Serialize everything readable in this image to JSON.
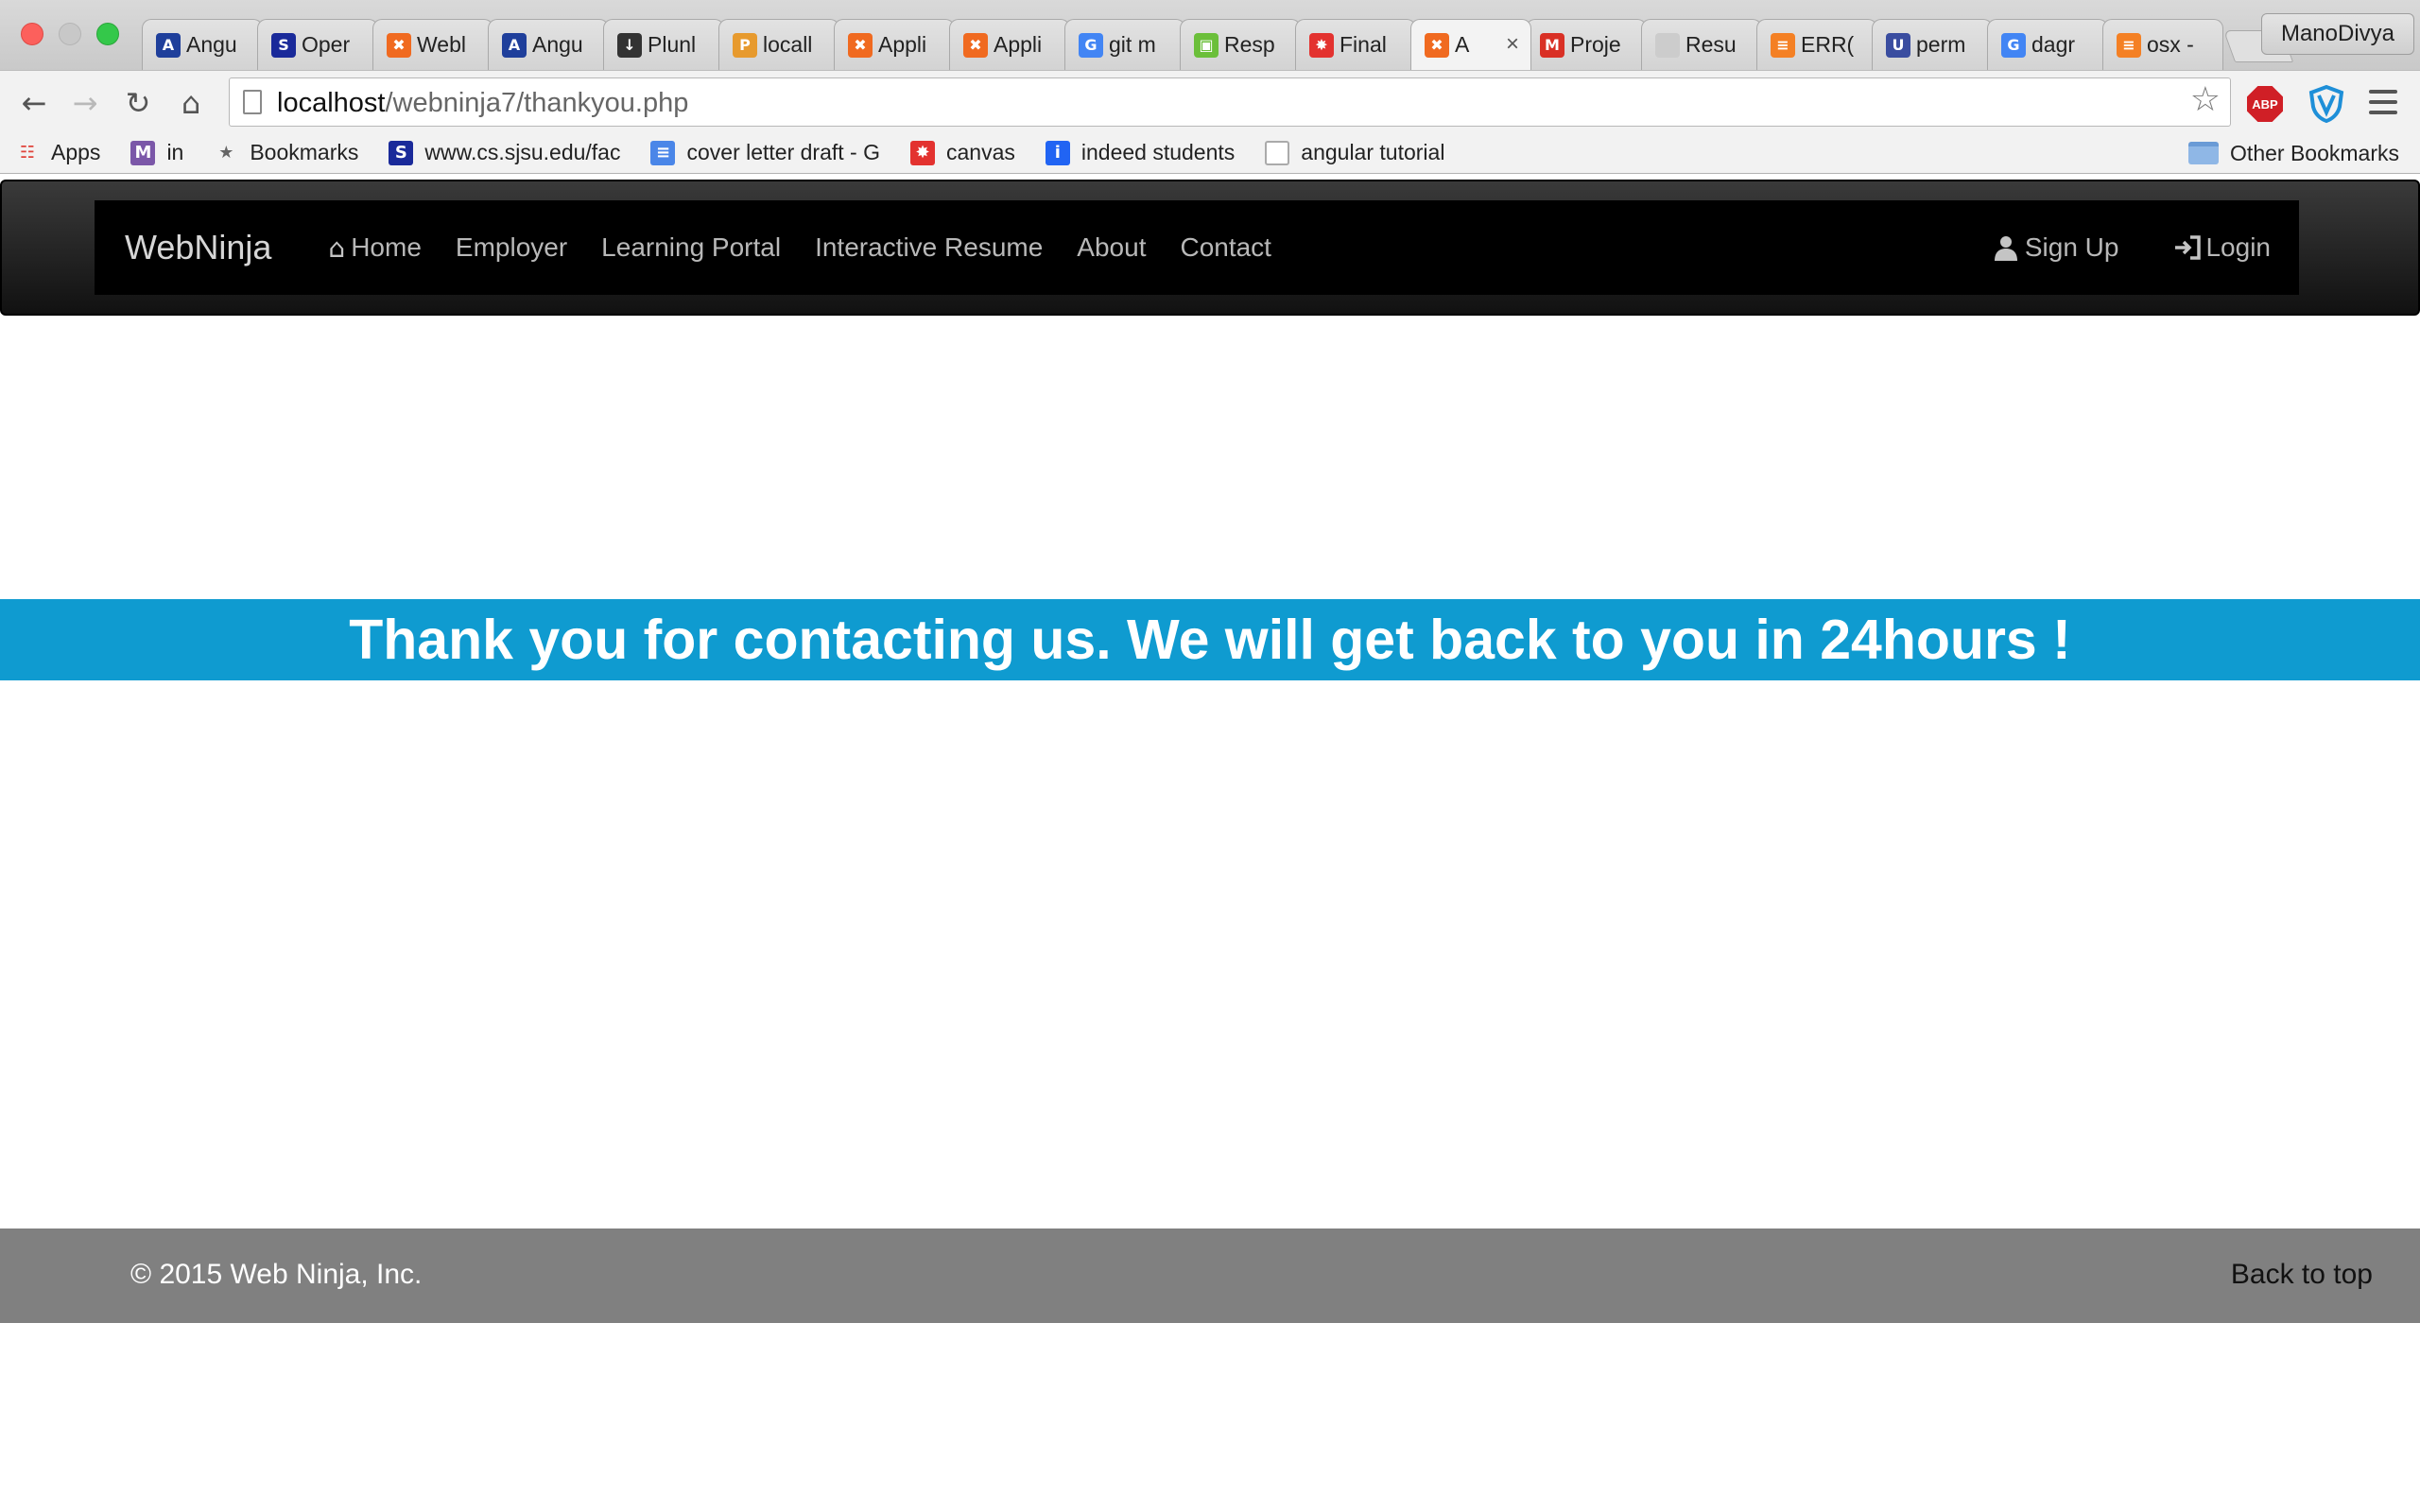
{
  "browser": {
    "profile_name": "ManoDivya",
    "tabs": [
      {
        "label": "Angu",
        "icon": "angular-icon",
        "color": "#1f3f9b"
      },
      {
        "label": "Oper",
        "icon": "sjsu-icon",
        "color": "#1a2a9a"
      },
      {
        "label": "Webl",
        "icon": "xampp-icon",
        "color": "#f06a20"
      },
      {
        "label": "Angu",
        "icon": "angular-icon",
        "color": "#1f3f9b"
      },
      {
        "label": "Plunl",
        "icon": "plunker-icon",
        "color": "#333333"
      },
      {
        "label": "locall",
        "icon": "phpmyadmin-icon",
        "color": "#e79a2e"
      },
      {
        "label": "Appli",
        "icon": "xampp-icon",
        "color": "#f06a20"
      },
      {
        "label": "Appli",
        "icon": "xampp-icon",
        "color": "#f06a20"
      },
      {
        "label": "git m",
        "icon": "google-icon",
        "color": "#4285f4"
      },
      {
        "label": "Resp",
        "icon": "responsive-icon",
        "color": "#6bbf3a"
      },
      {
        "label": "Final",
        "icon": "canvas-icon",
        "color": "#e3322f"
      },
      {
        "label": "A",
        "icon": "xampp-icon",
        "color": "#f06a20",
        "active": true
      },
      {
        "label": "Proje",
        "icon": "gmail-icon",
        "color": "#d93025"
      },
      {
        "label": "Resu",
        "icon": "document-icon",
        "color": "#cccccc"
      },
      {
        "label": "ERR(",
        "icon": "stackoverflow-icon",
        "color": "#f48024"
      },
      {
        "label": "perm",
        "icon": "ul-icon",
        "color": "#3a4da0"
      },
      {
        "label": "dagr",
        "icon": "google-icon",
        "color": "#4285f4"
      },
      {
        "label": "osx -",
        "icon": "stackoverflow-icon",
        "color": "#f48024"
      }
    ],
    "url_host": "localhost",
    "url_path": "/webninja7/thankyou.php",
    "bookmarks": [
      {
        "label": "Apps",
        "icon": "apps-grid-icon",
        "color": "#e0433a"
      },
      {
        "label": "in",
        "icon": "mcs-icon",
        "color": "#7b57a8"
      },
      {
        "label": "Bookmarks",
        "icon": "star-icon",
        "color": "#666666"
      },
      {
        "label": "www.cs.sjsu.edu/fac",
        "icon": "sjsu-icon",
        "color": "#1a2a9a"
      },
      {
        "label": "cover letter draft - G",
        "icon": "google-docs-icon",
        "color": "#4a86e8"
      },
      {
        "label": "canvas",
        "icon": "canvas-icon",
        "color": "#e3322f"
      },
      {
        "label": "indeed students",
        "icon": "indeed-icon",
        "color": "#2164f3"
      },
      {
        "label": "angular tutorial",
        "icon": "document-icon",
        "color": "#cccccc"
      }
    ],
    "other_bookmarks": "Other Bookmarks"
  },
  "site": {
    "brand": "WebNinja",
    "nav": {
      "home": "Home",
      "employer": "Employer",
      "learning_portal": "Learning Portal",
      "interactive_resume": "Interactive Resume",
      "about": "About",
      "contact": "Contact",
      "sign_up": "Sign Up",
      "login": "Login"
    },
    "banner_message": "Thank you for contacting us. We will get back to you in 24hours !",
    "footer": {
      "copyright": "© 2015 Web Ninja, Inc.",
      "back_to_top": "Back to top"
    }
  }
}
